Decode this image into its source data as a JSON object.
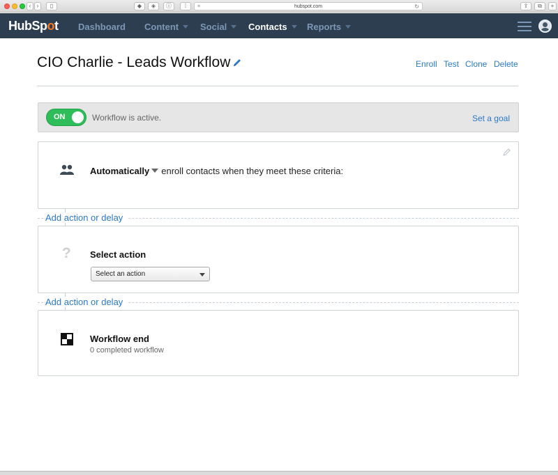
{
  "browser": {
    "url": "hubspot.com"
  },
  "nav": {
    "logo_pre": "HubSp",
    "logo_accent": "o",
    "logo_post": "t",
    "items": [
      {
        "label": "Dashboard",
        "has_caret": false,
        "active": false
      },
      {
        "label": "Content",
        "has_caret": true,
        "active": false
      },
      {
        "label": "Social",
        "has_caret": true,
        "active": false
      },
      {
        "label": "Contacts",
        "has_caret": true,
        "active": true
      },
      {
        "label": "Reports",
        "has_caret": true,
        "active": false
      }
    ],
    "colors": {
      "bar": "#2d3e50",
      "accent": "#f57722"
    }
  },
  "header": {
    "title": "CIO Charlie - Leads Workflow",
    "actions": [
      "Enroll",
      "Test",
      "Clone",
      "Delete"
    ]
  },
  "status": {
    "toggle_label": "ON",
    "toggle_on": true,
    "text": "Workflow is active.",
    "goal_link": "Set a goal"
  },
  "workflow": {
    "trigger": {
      "mode": "Automatically",
      "text": "enroll contacts when they meet these criteria:"
    },
    "add_action_label": "Add action or delay",
    "action": {
      "title": "Select action",
      "select_value": "Select an action"
    },
    "end": {
      "title": "Workflow end",
      "subtitle": "0 completed workflow"
    }
  }
}
